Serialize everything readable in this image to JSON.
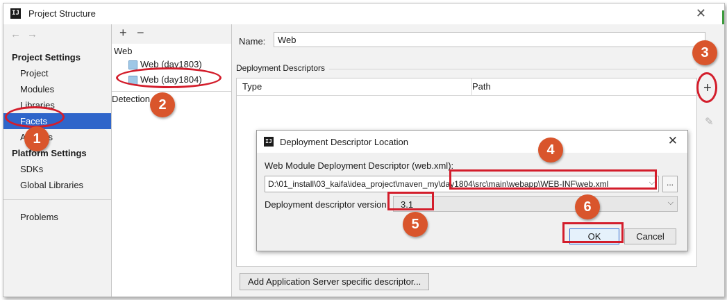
{
  "window": {
    "title": "Project Structure",
    "icon_text": "IJ",
    "close_symbol": "✕"
  },
  "nav": {
    "arrows": "←→",
    "project_settings_header": "Project Settings",
    "project_settings_items": [
      "Project",
      "Modules",
      "Libraries",
      "Facets",
      "Artifacts"
    ],
    "platform_settings_header": "Platform Settings",
    "platform_settings_items": [
      "SDKs",
      "Global Libraries"
    ],
    "problems": "Problems",
    "selected": "Facets"
  },
  "facets_panel": {
    "add_symbol": "+",
    "remove_symbol": "−",
    "root": "Web",
    "items": [
      "Web (day1803)",
      "Web (day1804)"
    ],
    "selected": "Web (day1804)",
    "detection": "Detection"
  },
  "facet_editor": {
    "name_label": "Name:",
    "name_value": "Web",
    "deployment_descriptors_label": "Deployment Descriptors",
    "columns": [
      "Type",
      "Path"
    ],
    "add_symbol": "+",
    "edit_symbol": "✎",
    "add_server_button": "Add Application Server specific descriptor..."
  },
  "dialog": {
    "title": "Deployment Descriptor Location",
    "icon_text": "IJ",
    "close_symbol": "✕",
    "descriptor_label": "Web Module Deployment Descriptor (web.xml):",
    "path_value": "D:\\01_install\\03_kaifa\\idea_project\\maven_my\\day1804\\src\\main\\webapp\\WEB-INF\\web.xml",
    "browse_label": "...",
    "version_label": "Deployment descriptor version",
    "version_value": "3.1",
    "ok_label": "OK",
    "cancel_label": "Cancel",
    "dropdown_symbol": "⌵"
  },
  "annotations": {
    "badges": [
      "1",
      "2",
      "3",
      "4",
      "5",
      "6"
    ],
    "badge_color": "#d9552c",
    "highlight_color": "#d31d2b"
  },
  "colors": {
    "selection": "#2f65ca",
    "ok_border": "#2f6bd6"
  }
}
